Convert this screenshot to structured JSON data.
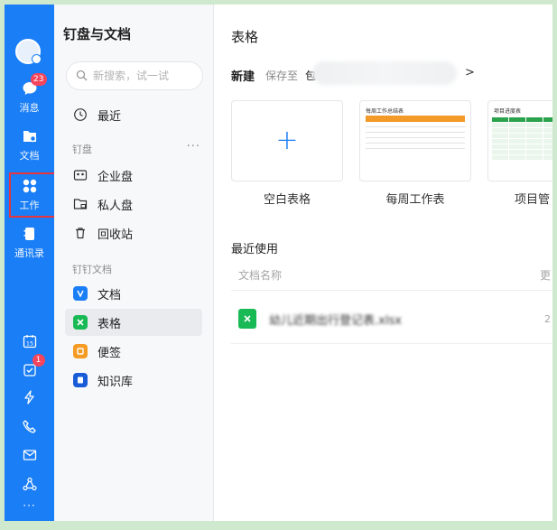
{
  "rail": {
    "items": [
      {
        "id": "messages",
        "label": "消息",
        "badge": "23",
        "icon": "chat-bubble-icon"
      },
      {
        "id": "docs",
        "label": "文档",
        "icon": "docs-folder-icon"
      },
      {
        "id": "work",
        "label": "工作",
        "icon": "grid-apps-icon"
      },
      {
        "id": "contacts",
        "label": "通讯录",
        "icon": "contacts-book-icon"
      }
    ],
    "bottom_icons": [
      {
        "id": "calendar",
        "text": "15",
        "icon": "calendar-icon"
      },
      {
        "id": "todo",
        "badge": "1",
        "icon": "todo-check-icon"
      },
      {
        "id": "ding",
        "icon": "lightning-icon"
      },
      {
        "id": "call",
        "icon": "phone-call-icon"
      },
      {
        "id": "mail",
        "icon": "mail-icon"
      },
      {
        "id": "apps",
        "icon": "network-icon"
      }
    ],
    "more": "···",
    "accent": "#1a7ef7"
  },
  "side": {
    "title": "钉盘与文档",
    "search_placeholder": "新搜索，试一试",
    "recent": "最近",
    "section_dingpan": "钉盘",
    "section_dingpan_more": "···",
    "enterprise": "企业盘",
    "private": "私人盘",
    "recycle": "回收站",
    "section_docs": "钉钉文档",
    "docs": [
      {
        "label": "文档",
        "color": "#1a7ef7"
      },
      {
        "label": "表格",
        "color": "#19b955"
      },
      {
        "label": "便签",
        "color": "#f59a23"
      },
      {
        "label": "知识库",
        "color": "#1a5bd8"
      }
    ]
  },
  "main": {
    "title": "表格",
    "new_label": "新建",
    "save_to": "保存至",
    "path_prefix": "包",
    "path_chevron": ">",
    "templates": [
      {
        "label": "空白表格",
        "plus": "+"
      },
      {
        "label": "每周工作表",
        "thumb_title": "每周工作总结表"
      },
      {
        "label": "项目管",
        "thumb_title": "项目进度表"
      }
    ],
    "recent_title": "最近使用",
    "col_name": "文档名称",
    "col_right": "更",
    "file_name": "幼儿近期出行登记表.xlsx",
    "file_right": "2"
  }
}
